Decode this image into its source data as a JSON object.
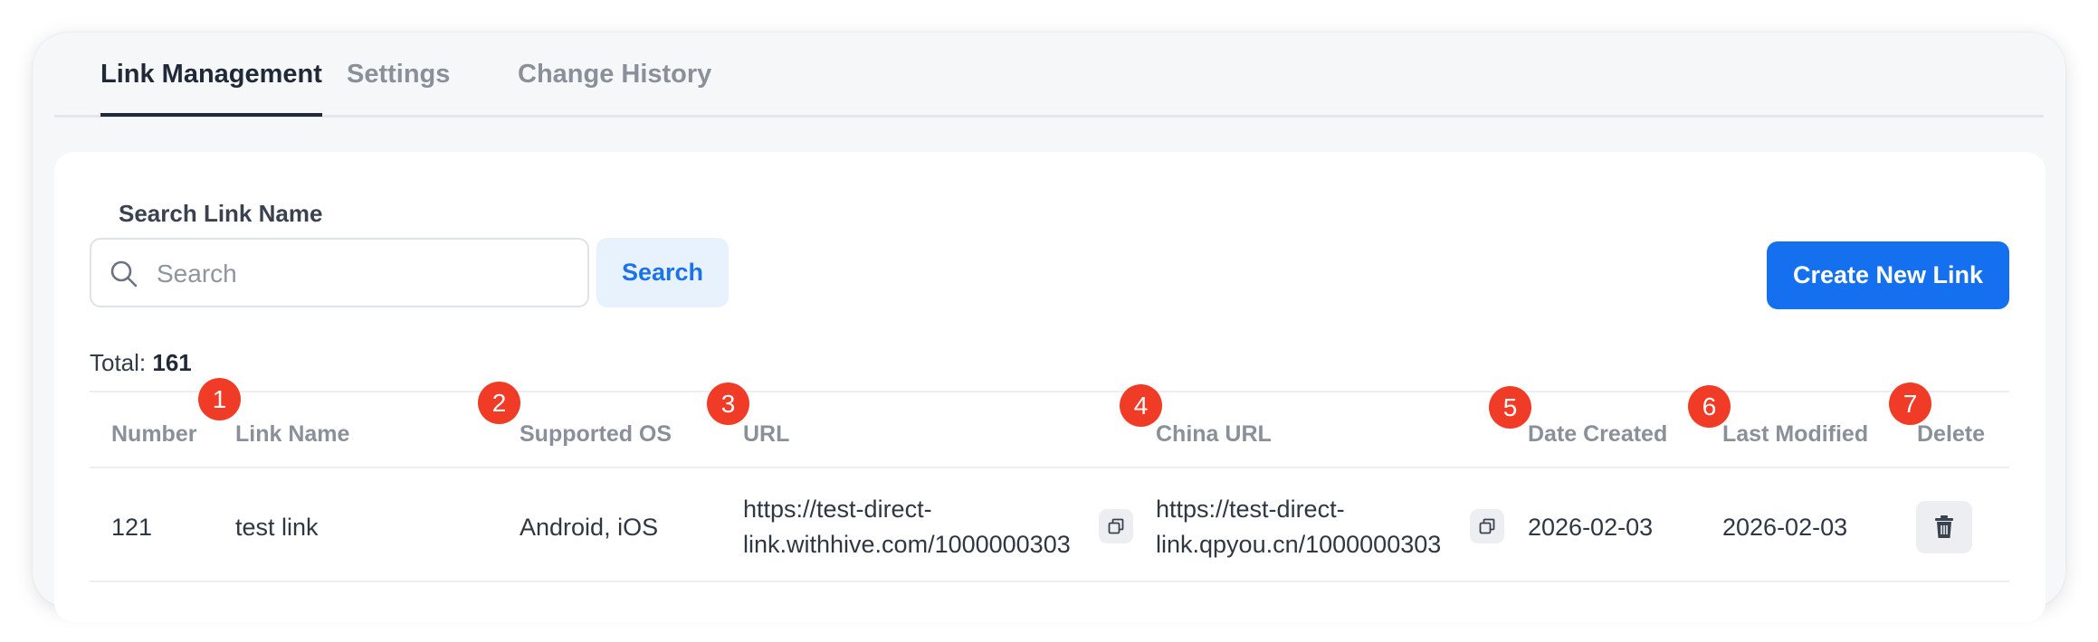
{
  "tabs": [
    {
      "label": "Link Management",
      "active": true
    },
    {
      "label": "Settings",
      "active": false
    },
    {
      "label": "Change History",
      "active": false
    }
  ],
  "search": {
    "label": "Search Link Name",
    "placeholder": "Search",
    "value": "",
    "button_label": "Search"
  },
  "create_button_label": "Create New Link",
  "total": {
    "label": "Total:",
    "count": "161"
  },
  "table": {
    "columns": [
      "Number",
      "Link Name",
      "Supported OS",
      "URL",
      "China URL",
      "Date Created",
      "Last Modified",
      "Delete"
    ],
    "rows": [
      {
        "number": "121",
        "link_name": "test link",
        "supported_os": "Android, iOS",
        "url_line1": "https://test-direct-",
        "url_line2": "link.withhive.com/1000000303",
        "china_url_line1": "https://test-direct-",
        "china_url_line2": "link.qpyou.cn/1000000303",
        "date_created": "2026-02-03",
        "last_modified": "2026-02-03"
      }
    ]
  },
  "markers": [
    "1",
    "2",
    "3",
    "4",
    "5",
    "6",
    "7"
  ],
  "colors": {
    "accent": "#1570ef",
    "marker": "#f03c26",
    "search_button_bg": "#e8f2fd"
  },
  "icons": [
    "search-icon",
    "copy-icon",
    "trash-icon"
  ]
}
